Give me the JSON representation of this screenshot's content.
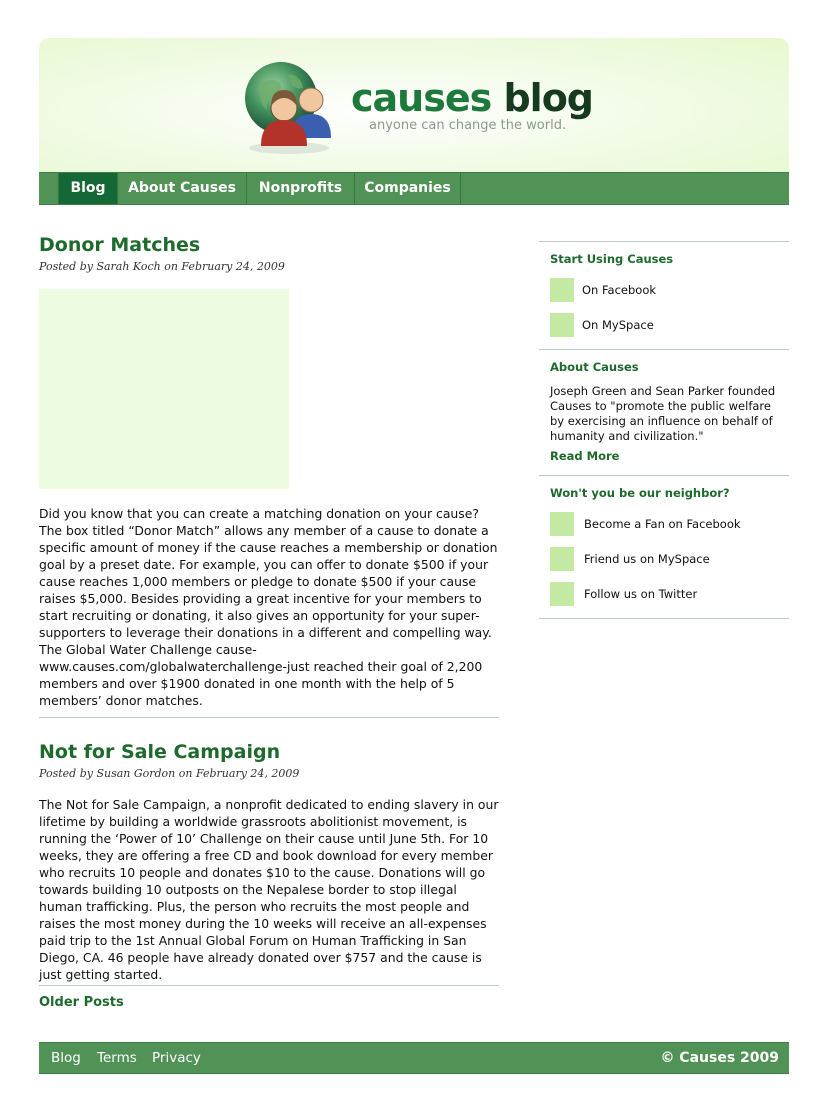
{
  "header": {
    "logo_word1": "causes",
    "logo_word2": "blog",
    "tagline": "anyone can change the world."
  },
  "nav": {
    "items": [
      {
        "label": "Blog",
        "active": true
      },
      {
        "label": "About Causes",
        "active": false
      },
      {
        "label": "Nonprofits",
        "active": false
      },
      {
        "label": "Companies",
        "active": false
      }
    ]
  },
  "posts": [
    {
      "title": "Donor Matches",
      "meta": "Posted by Sarah Koch on February 24, 2009",
      "body": "Did you know that you can create a matching donation on your cause? The box titled “Donor Match” allows any member of a cause to donate a specific amount of money if the cause reaches a membership or donation goal by a preset date. For example, you can offer to donate $500 if your cause reaches 1,000 members or pledge to donate $500 if your cause raises $5,000. Besides providing a great incentive for your members to start recruiting or donating, it also gives an opportunity for your super-supporters to leverage their donations in a different and compelling way. The Global Water Challenge cause- www.causes.com/globalwaterchallenge-just reached their goal of 2,200 members and over $1900 donated in one month with the help of 5 members’ donor matches."
    },
    {
      "title": "Not for Sale Campaign",
      "meta": "Posted by Susan Gordon on February 24, 2009",
      "body": "The Not for Sale Campaign, a nonprofit dedicated to ending slavery in our lifetime by building a worldwide grassroots abolitionist movement, is running the ‘Power of 10’ Challenge on their cause until June 5th. For 10 weeks, they are offering a free CD and book download for every member who recruits 10 people and donates $10 to the cause. Donations will go towards building 10 outposts on the Nepalese border to stop illegal human trafficking. Plus, the person who recruits the most people and raises the most money during the 10 weeks will receive an all-expenses paid trip to the 1st Annual Global Forum on Human Trafficking in San Diego, CA. 46 people have already donated over $757 and the cause is just getting started."
    }
  ],
  "older_posts": "Older Posts",
  "sidebar": {
    "start": {
      "title": "Start Using Causes",
      "links": [
        "On Facebook",
        "On MySpace"
      ]
    },
    "about": {
      "title": "About Causes",
      "text": "Joseph Green and Sean Parker founded Causes to \"promote the public welfare by exercising an influence on behalf of humanity and civilization.\"",
      "read_more": "Read More"
    },
    "neighbor": {
      "title": "Won't you be our neighbor?",
      "links": [
        "Become a Fan on Facebook",
        "Friend us on MySpace",
        "Follow us on Twitter"
      ]
    }
  },
  "footer": {
    "links": [
      "Blog",
      "Terms",
      "Privacy"
    ],
    "copyright": "© Causes 2009"
  },
  "colors": {
    "brand_green": "#1e6a2c",
    "nav_bg": "#519357",
    "nav_active": "#136835",
    "placeholder": "#c4e9a3"
  }
}
